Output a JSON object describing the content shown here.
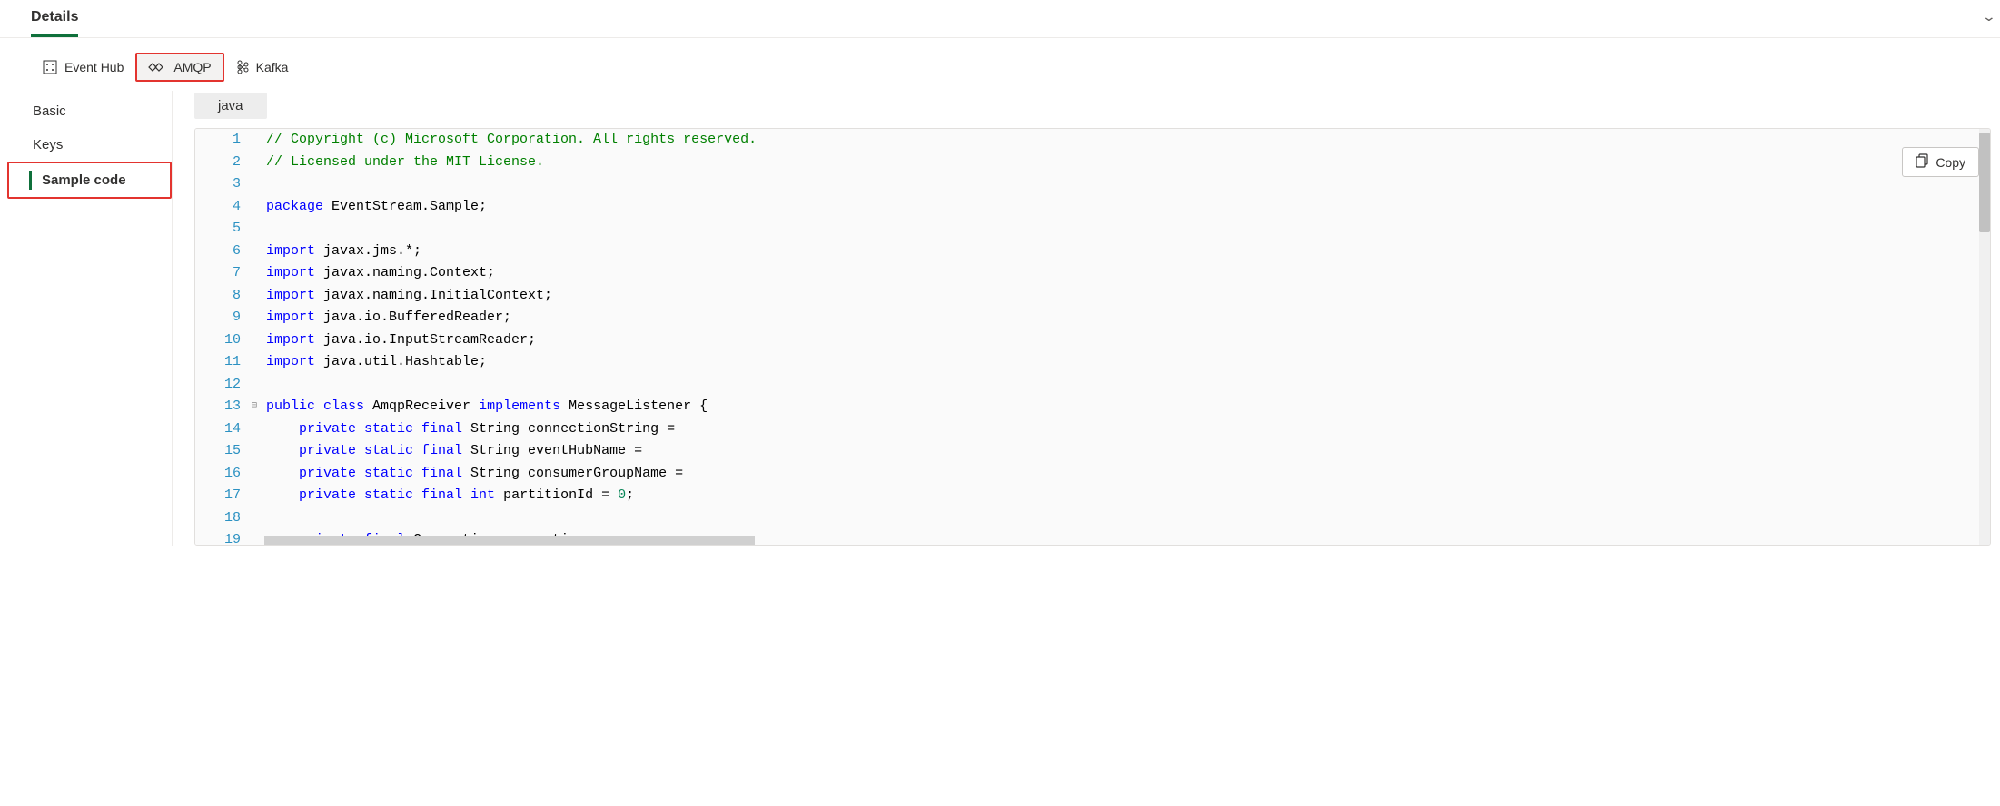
{
  "details": {
    "title": "Details"
  },
  "protoTabs": {
    "eventHub": "Event Hub",
    "amqp": "AMQP",
    "kafka": "Kafka"
  },
  "sideNav": {
    "basic": "Basic",
    "keys": "Keys",
    "sampleCode": "Sample code"
  },
  "language": "java",
  "copy": "Copy",
  "code": {
    "lines": [
      {
        "n": 1,
        "tokens": [
          [
            "comment",
            "// Copyright (c) Microsoft Corporation. All rights reserved."
          ]
        ]
      },
      {
        "n": 2,
        "tokens": [
          [
            "comment",
            "// Licensed under the MIT License."
          ]
        ]
      },
      {
        "n": 3,
        "tokens": []
      },
      {
        "n": 4,
        "tokens": [
          [
            "keyword",
            "package"
          ],
          [
            "plain",
            " EventStream.Sample;"
          ]
        ]
      },
      {
        "n": 5,
        "tokens": []
      },
      {
        "n": 6,
        "tokens": [
          [
            "keyword",
            "import"
          ],
          [
            "plain",
            " javax.jms.*;"
          ]
        ]
      },
      {
        "n": 7,
        "tokens": [
          [
            "keyword",
            "import"
          ],
          [
            "plain",
            " javax.naming.Context;"
          ]
        ]
      },
      {
        "n": 8,
        "tokens": [
          [
            "keyword",
            "import"
          ],
          [
            "plain",
            " javax.naming.InitialContext;"
          ]
        ]
      },
      {
        "n": 9,
        "tokens": [
          [
            "keyword",
            "import"
          ],
          [
            "plain",
            " java.io.BufferedReader;"
          ]
        ]
      },
      {
        "n": 10,
        "tokens": [
          [
            "keyword",
            "import"
          ],
          [
            "plain",
            " java.io.InputStreamReader;"
          ]
        ]
      },
      {
        "n": 11,
        "tokens": [
          [
            "keyword",
            "import"
          ],
          [
            "plain",
            " java.util.Hashtable;"
          ]
        ]
      },
      {
        "n": 12,
        "tokens": []
      },
      {
        "n": 13,
        "fold": true,
        "tokens": [
          [
            "keyword",
            "public class"
          ],
          [
            "plain",
            " AmqpReceiver "
          ],
          [
            "keyword",
            "implements"
          ],
          [
            "plain",
            " MessageListener {"
          ]
        ]
      },
      {
        "n": 14,
        "tokens": [
          [
            "plain",
            "    "
          ],
          [
            "keyword",
            "private static final"
          ],
          [
            "plain",
            " String connectionString ="
          ]
        ]
      },
      {
        "n": 15,
        "tokens": [
          [
            "plain",
            "    "
          ],
          [
            "keyword",
            "private static final"
          ],
          [
            "plain",
            " String eventHubName ="
          ]
        ]
      },
      {
        "n": 16,
        "tokens": [
          [
            "plain",
            "    "
          ],
          [
            "keyword",
            "private static final"
          ],
          [
            "plain",
            " String consumerGroupName ="
          ]
        ]
      },
      {
        "n": 17,
        "tokens": [
          [
            "plain",
            "    "
          ],
          [
            "keyword",
            "private static final int"
          ],
          [
            "plain",
            " partitionId = "
          ],
          [
            "number",
            "0"
          ],
          [
            "plain",
            ";"
          ]
        ]
      },
      {
        "n": 18,
        "tokens": []
      },
      {
        "n": 19,
        "tokens": [
          [
            "plain",
            "    "
          ],
          [
            "keyword",
            "private final"
          ],
          [
            "plain",
            " Connection connection;"
          ]
        ]
      }
    ]
  }
}
